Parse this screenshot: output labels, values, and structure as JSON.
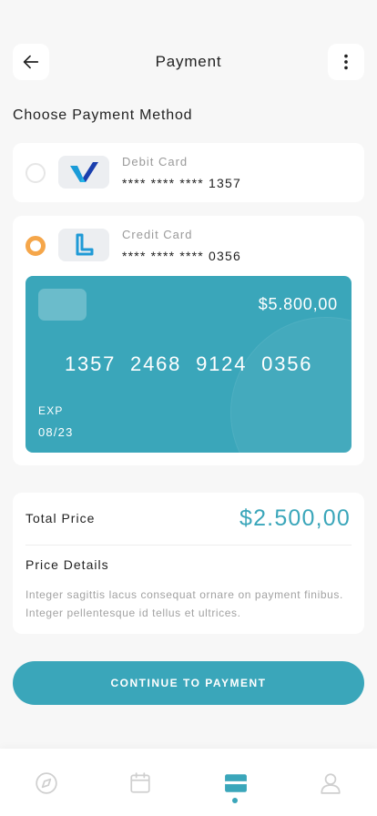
{
  "header": {
    "title": "Payment",
    "back_icon": "arrow-left-icon",
    "menu_icon": "more-vertical-icon"
  },
  "section_title": "Choose Payment Method",
  "methods": [
    {
      "type": "Debit Card",
      "number": "**** **** **** 1357",
      "selected": false,
      "logo_icon": "v-logo-icon"
    },
    {
      "type": "Credit Card",
      "number": "**** **** **** 0356",
      "selected": true,
      "logo_icon": "l-logo-icon",
      "card": {
        "balance": "$5.800,00",
        "number": "1357 2468 9124 0356",
        "exp_label": "EXP",
        "exp_value": "08/23"
      }
    }
  ],
  "total": {
    "label": "Total Price",
    "value": "$2.500,00",
    "details_label": "Price Details",
    "details_text": "Integer sagittis lacus consequat ornare on payment finibus. Integer pellentesque id tellus et ultrices."
  },
  "cta_label": "CONTINUE TO PAYMENT",
  "bottom_nav": {
    "items": [
      "compass-icon",
      "calendar-icon",
      "card-icon",
      "user-icon"
    ],
    "active_index": 2
  },
  "colors": {
    "accent": "#3aa6ba",
    "radio_selected": "#f5a64a",
    "background": "#f7f7f7"
  }
}
